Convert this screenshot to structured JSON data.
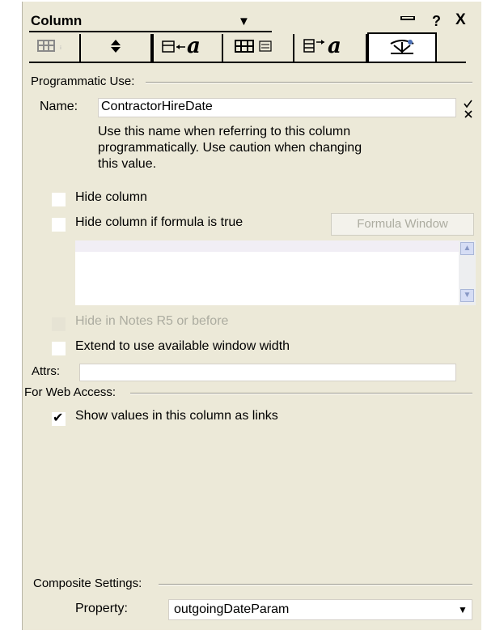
{
  "header": {
    "title": "Column",
    "caret_icon": "dropdown-caret-icon",
    "dock_icon": "dock-icon",
    "help_label": "?",
    "close_label": "X"
  },
  "tabs": [
    {
      "name": "column-info",
      "active": false
    },
    {
      "name": "sorting",
      "active": false
    },
    {
      "name": "header-font",
      "active": false
    },
    {
      "name": "number-format",
      "active": false
    },
    {
      "name": "title-font",
      "active": false
    },
    {
      "name": "advanced",
      "active": true
    }
  ],
  "programmatic": {
    "section_label": "Programmatic Use:",
    "name_label": "Name:",
    "name_value": "ContractorHireDate",
    "help_text_1": "Use this name when referring to this column",
    "help_text_2": "programmatically.  Use caution when changing",
    "help_text_3": "this value.",
    "hide_column_label": "Hide column",
    "hide_column_checked": false,
    "hide_if_formula_label": "Hide column if formula is true",
    "hide_if_formula_checked": false,
    "formula_window_label": "Formula Window",
    "hide_in_r5_label": "Hide in Notes R5 or before",
    "hide_in_r5_checked": false,
    "extend_label": "Extend to use available window width",
    "extend_checked": false,
    "attrs_label": "Attrs:",
    "attrs_value": ""
  },
  "web": {
    "section_label": "For Web Access:",
    "show_links_label": "Show values in this column as links",
    "show_links_checked": true
  },
  "composite": {
    "section_label": "Composite Settings:",
    "property_label": "Property:",
    "property_value": "outgoingDateParam"
  }
}
